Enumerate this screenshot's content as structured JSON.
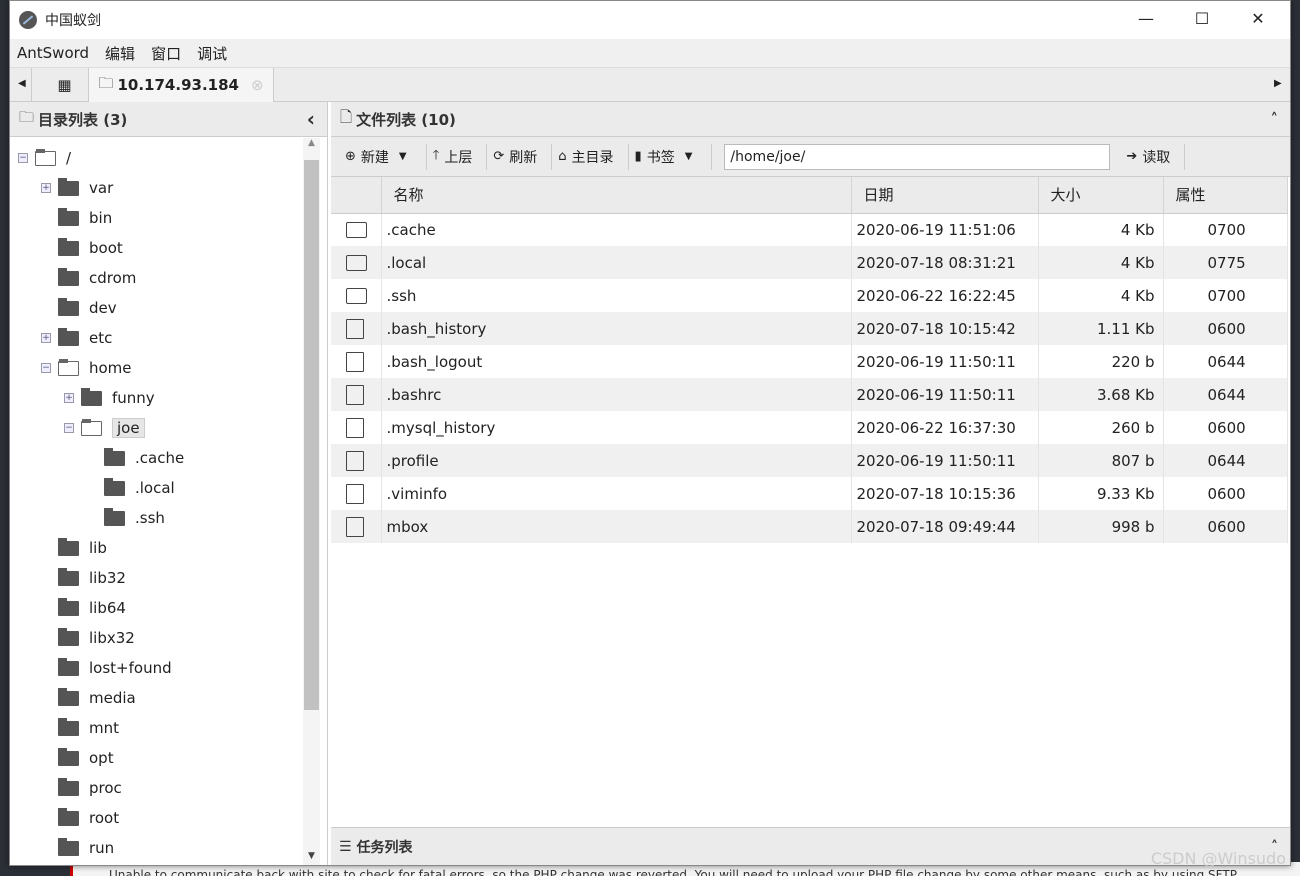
{
  "window": {
    "title": "中国蚁剑",
    "minimize": "—",
    "maximize": "☐",
    "close": "✕"
  },
  "menu": [
    "AntSword",
    "编辑",
    "窗口",
    "调试"
  ],
  "tabs": {
    "home_icon": "grid-icon",
    "active_label": "10.174.93.184"
  },
  "left_panel": {
    "title": "目录列表 (3)",
    "collapse": "‹",
    "tree": [
      {
        "label": "/",
        "depth": 0,
        "open": true,
        "expander": "−"
      },
      {
        "label": "var",
        "depth": 1,
        "expander": "+"
      },
      {
        "label": "bin",
        "depth": 1
      },
      {
        "label": "boot",
        "depth": 1
      },
      {
        "label": "cdrom",
        "depth": 1
      },
      {
        "label": "dev",
        "depth": 1
      },
      {
        "label": "etc",
        "depth": 1,
        "expander": "+"
      },
      {
        "label": "home",
        "depth": 1,
        "open": true,
        "expander": "−"
      },
      {
        "label": "funny",
        "depth": 2,
        "expander": "+"
      },
      {
        "label": "joe",
        "depth": 2,
        "open": true,
        "expander": "−",
        "selected": true
      },
      {
        "label": ".cache",
        "depth": 3
      },
      {
        "label": ".local",
        "depth": 3
      },
      {
        "label": ".ssh",
        "depth": 3
      },
      {
        "label": "lib",
        "depth": 1
      },
      {
        "label": "lib32",
        "depth": 1
      },
      {
        "label": "lib64",
        "depth": 1
      },
      {
        "label": "libx32",
        "depth": 1
      },
      {
        "label": "lost+found",
        "depth": 1
      },
      {
        "label": "media",
        "depth": 1
      },
      {
        "label": "mnt",
        "depth": 1
      },
      {
        "label": "opt",
        "depth": 1
      },
      {
        "label": "proc",
        "depth": 1
      },
      {
        "label": "root",
        "depth": 1
      },
      {
        "label": "run",
        "depth": 1
      }
    ]
  },
  "right_panel": {
    "title": "文件列表 (10)",
    "collapse": "˄",
    "toolbar": {
      "new": "新建",
      "up": "上层",
      "refresh": "刷新",
      "home": "主目录",
      "bookmark": "书签",
      "path": "/home/joe/",
      "read": "读取"
    },
    "columns": [
      "名称",
      "日期",
      "大小",
      "属性"
    ],
    "files": [
      {
        "type": "folder",
        "name": ".cache",
        "date": "2020-06-19 11:51:06",
        "size": "4 Kb",
        "perm": "0700"
      },
      {
        "type": "folder",
        "name": ".local",
        "date": "2020-07-18 08:31:21",
        "size": "4 Kb",
        "perm": "0775"
      },
      {
        "type": "folder",
        "name": ".ssh",
        "date": "2020-06-22 16:22:45",
        "size": "4 Kb",
        "perm": "0700"
      },
      {
        "type": "file",
        "name": ".bash_history",
        "date": "2020-07-18 10:15:42",
        "size": "1.11 Kb",
        "perm": "0600"
      },
      {
        "type": "file",
        "name": ".bash_logout",
        "date": "2020-06-19 11:50:11",
        "size": "220 b",
        "perm": "0644"
      },
      {
        "type": "file",
        "name": ".bashrc",
        "date": "2020-06-19 11:50:11",
        "size": "3.68 Kb",
        "perm": "0644"
      },
      {
        "type": "file",
        "name": ".mysql_history",
        "date": "2020-06-22 16:37:30",
        "size": "260 b",
        "perm": "0600"
      },
      {
        "type": "file",
        "name": ".profile",
        "date": "2020-06-19 11:50:11",
        "size": "807 b",
        "perm": "0644"
      },
      {
        "type": "file",
        "name": ".viminfo",
        "date": "2020-07-18 10:15:36",
        "size": "9.33 Kb",
        "perm": "0600"
      },
      {
        "type": "file",
        "name": "mbox",
        "date": "2020-07-18 09:49:44",
        "size": "998 b",
        "perm": "0600"
      }
    ]
  },
  "task_panel": {
    "title": "任务列表"
  },
  "watermark": "CSDN @Winsudo",
  "background_notice": "Unable to communicate back with site to check for fatal errors, so the PHP change was reverted. You will need to upload your PHP file change by some other means, such as by using SFTP."
}
